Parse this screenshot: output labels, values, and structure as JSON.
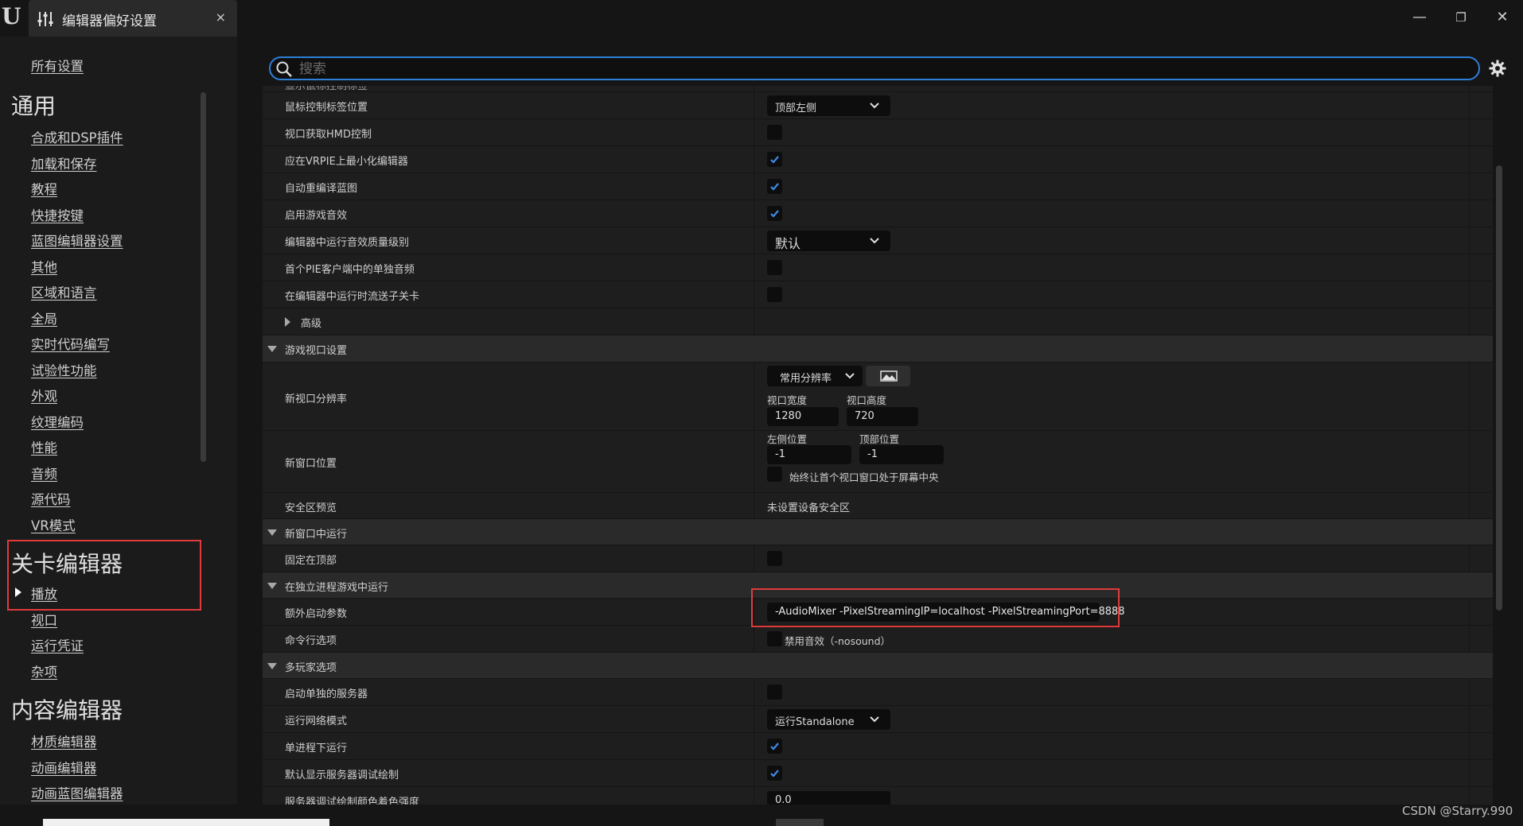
{
  "window": {
    "tab_title": "编辑器偏好设置",
    "close_glyph": "×",
    "minimize_glyph": "—",
    "restore_glyph": "❐",
    "winclose_glyph": "✕"
  },
  "sidebar": {
    "all_settings": "所有设置",
    "sections": [
      {
        "header": "通用",
        "items": [
          "合成和DSP插件",
          "加载和保存",
          "教程",
          "快捷按键",
          "蓝图编辑器设置",
          "其他",
          "区域和语言",
          "全局",
          "实时代码编写",
          "试验性功能",
          "外观",
          "纹理编码",
          "性能",
          "音频",
          "源代码",
          "VR模式"
        ]
      },
      {
        "header": "关卡编辑器",
        "items": [
          "播放",
          "视口",
          "运行凭证",
          "杂项"
        ]
      },
      {
        "header": "内容编辑器",
        "items": [
          "材质编辑器",
          "动画编辑器",
          "动画蓝图编辑器"
        ]
      }
    ]
  },
  "search": {
    "placeholder": "搜索",
    "value": ""
  },
  "settings": {
    "partial_top_label": "显示鼠标控制标签",
    "mouse_label_pos": {
      "label": "鼠标控制标签位置",
      "value": "顶部左侧"
    },
    "viewport_hmd": {
      "label": "视口获取HMD控制",
      "checked": false
    },
    "minimize_vrpie": {
      "label": "应在VRPIE上最小化编辑器",
      "checked": true
    },
    "auto_recompile": {
      "label": "自动重编译蓝图",
      "checked": true
    },
    "enable_game_sound": {
      "label": "启用游戏音效",
      "checked": true
    },
    "audio_quality": {
      "label": "编辑器中运行音效质量级别",
      "value": "默认"
    },
    "pie_audio": {
      "label": "首个PIE客户端中的单独音频",
      "checked": false
    },
    "stream_sublevels": {
      "label": "在编辑器中运行时流送子关卡",
      "checked": false
    },
    "advanced": "高级",
    "game_viewport_cat": "游戏视口设置",
    "new_viewport_res": {
      "label": "新视口分辨率",
      "preset": "常用分辨率",
      "width_label": "视口宽度",
      "height_label": "视口高度",
      "width": "1280",
      "height": "720"
    },
    "new_window_pos": {
      "label": "新窗口位置",
      "left_label": "左侧位置",
      "top_label": "顶部位置",
      "left": "-1",
      "top": "-1",
      "center_label": "始终让首个视口窗口处于屏幕中央"
    },
    "safe_zone": {
      "label": "安全区预览",
      "value": "未设置设备安全区"
    },
    "new_window_cat": "新窗口中运行",
    "always_on_top": {
      "label": "固定在顶部",
      "checked": false
    },
    "standalone_cat": "在独立进程游戏中运行",
    "extra_args": {
      "label": "额外启动参数",
      "value": "-AudioMixer -PixelStreamingIP=localhost -PixelStreamingPort=8888"
    },
    "cmdline": {
      "label": "命令行选项",
      "option": "禁用音效（-nosound）"
    },
    "multiplayer_cat": "多玩家选项",
    "separate_server": {
      "label": "启动单独的服务器",
      "checked": false
    },
    "net_mode": {
      "label": "运行网络模式",
      "value": "运行Standalone"
    },
    "single_process": {
      "label": "单进程下运行",
      "checked": true
    },
    "server_debug_draw": {
      "label": "默认显示服务器调试绘制",
      "checked": true
    },
    "server_debug_color": {
      "label": "服务器调试绘制颜色着色强度",
      "value": "0.0"
    }
  },
  "watermark": "CSDN @Starry.990",
  "colors": {
    "accent": "#2f7fd8",
    "highlight": "#e03b3b",
    "checkmark": "#3b8beb"
  }
}
